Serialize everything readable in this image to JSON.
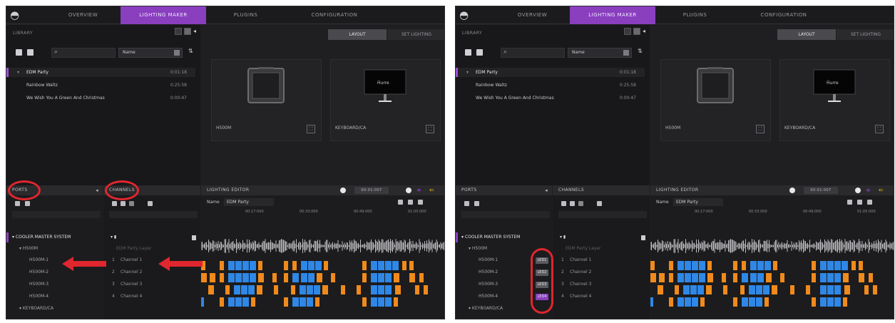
{
  "nav": {
    "tabs": [
      "OVERVIEW",
      "LIGHTING MAKER",
      "PLUGINS",
      "CONFIGURATION"
    ],
    "active": 1
  },
  "library": {
    "title": "LIBRARY",
    "sort_value": "Name",
    "playlists": [
      {
        "name": "EDM Party",
        "time": "0:01:18",
        "header": true
      },
      {
        "name": "Rainbow Waltz",
        "time": "0:25:58"
      },
      {
        "name": "We Wish You A Green And Christmas",
        "time": "0:00:47"
      }
    ]
  },
  "layout": {
    "tabs": [
      "LAYOUT",
      "SET LIGHTING"
    ],
    "devices": [
      {
        "label": "H500M",
        "icon": "case-icon"
      },
      {
        "label": "KEYBOARD/CA",
        "icon": "monitor-icon"
      }
    ]
  },
  "ports": {
    "title": "PORTS",
    "system": "COOLER MASTER SYSTEM",
    "group": "H500M",
    "ports": [
      "H500M-1",
      "H500M-2",
      "H500M-3",
      "H500M-4"
    ],
    "next_group": "KEYBOARD/CA",
    "badges": [
      "LED1",
      "LED2",
      "LED3",
      "LED4"
    ]
  },
  "channels": {
    "title": "CHANNELS",
    "placeholder": "EDM Party Layer",
    "items": [
      {
        "num": "1",
        "name": "Channel 1"
      },
      {
        "num": "2",
        "name": "Channel 2"
      },
      {
        "num": "3",
        "name": "Channel 3"
      },
      {
        "num": "4",
        "name": "Channel 4"
      }
    ]
  },
  "editor": {
    "title": "LIGHTING EDITOR",
    "time": "00:01:007",
    "name_label": "Name",
    "name_value": "EDM Party",
    "ticks": [
      "00:17:000",
      "00:33:000",
      "00:49:000",
      "01:05:000"
    ]
  },
  "colors": {
    "accent": "#8a3fbf",
    "orange": "#f08a1c",
    "blue": "#2f87e6",
    "highlight_red": "#e0262e"
  }
}
